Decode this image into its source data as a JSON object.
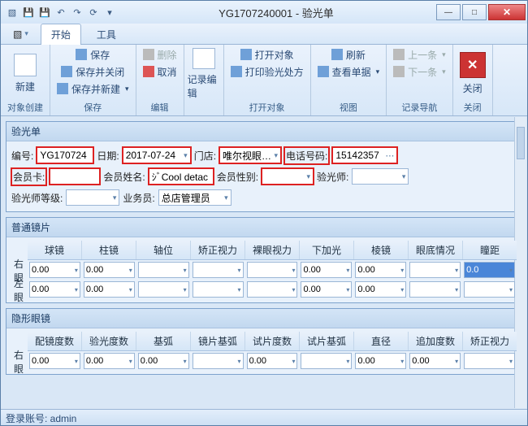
{
  "title": "YG1707240001 - 验光单",
  "tabs": {
    "start": "开始",
    "tools": "工具"
  },
  "ribbon": {
    "new": "新建",
    "g_create": "对象创建",
    "save": "保存",
    "save_close": "保存并关闭",
    "save_new": "保存并新建",
    "g_save": "保存",
    "delete": "删除",
    "cancel": "取消",
    "g_edit": "编辑",
    "rec_edit": "记录编辑",
    "open_obj": "打开对象",
    "print_rx": "打印验光处方",
    "g_open": "打开对象",
    "refresh": "刷新",
    "view_bill": "查看单据",
    "g_view": "视图",
    "prev": "上一条",
    "next": "下一条",
    "g_nav": "记录导航",
    "close": "关闭",
    "g_close": "关闭"
  },
  "panel1": {
    "title": "验光单",
    "no_lbl": "编号:",
    "no": "YG170724",
    "date_lbl": "日期:",
    "date": "2017-07-24",
    "store_lbl": "门店:",
    "store": "唯尔视眼…",
    "phone_lbl": "电话号码:",
    "phone": "15142357",
    "card_lbl": "会员卡:",
    "card": "",
    "mname_lbl": "会员姓名:",
    "mname": "ｼﾞCool detac",
    "sex_lbl": "会员性别:",
    "sex": "",
    "optom_lbl": "验光师:",
    "optom": "",
    "level_lbl": "验光师等级:",
    "level": "",
    "sales_lbl": "业务员:",
    "sales": "总店管理员"
  },
  "panel2": {
    "title": "普通镜片",
    "cols": [
      "球镜",
      "柱镜",
      "轴位",
      "矫正视力",
      "裸眼视力",
      "下加光",
      "棱镜",
      "眼底情况",
      "瞳距"
    ],
    "r_lbl": "右眼",
    "l_lbl": "左眼",
    "r": [
      "0.00",
      "0.00",
      "",
      "",
      "",
      "0.00",
      "0.00",
      "",
      "0.0"
    ],
    "l": [
      "0.00",
      "0.00",
      "",
      "",
      "",
      "0.00",
      "0.00",
      "",
      ""
    ]
  },
  "panel3": {
    "title": "隐形眼镜",
    "cols": [
      "配镜度数",
      "验光度数",
      "基弧",
      "镜片基弧",
      "试片度数",
      "试片基弧",
      "直径",
      "追加度数",
      "矫正视力"
    ],
    "r_lbl": "右眼",
    "r": [
      "0.00",
      "0.00",
      "0.00",
      "",
      "0.00",
      "",
      "0.00",
      "0.00",
      ""
    ]
  },
  "status": "登录账号: admin"
}
